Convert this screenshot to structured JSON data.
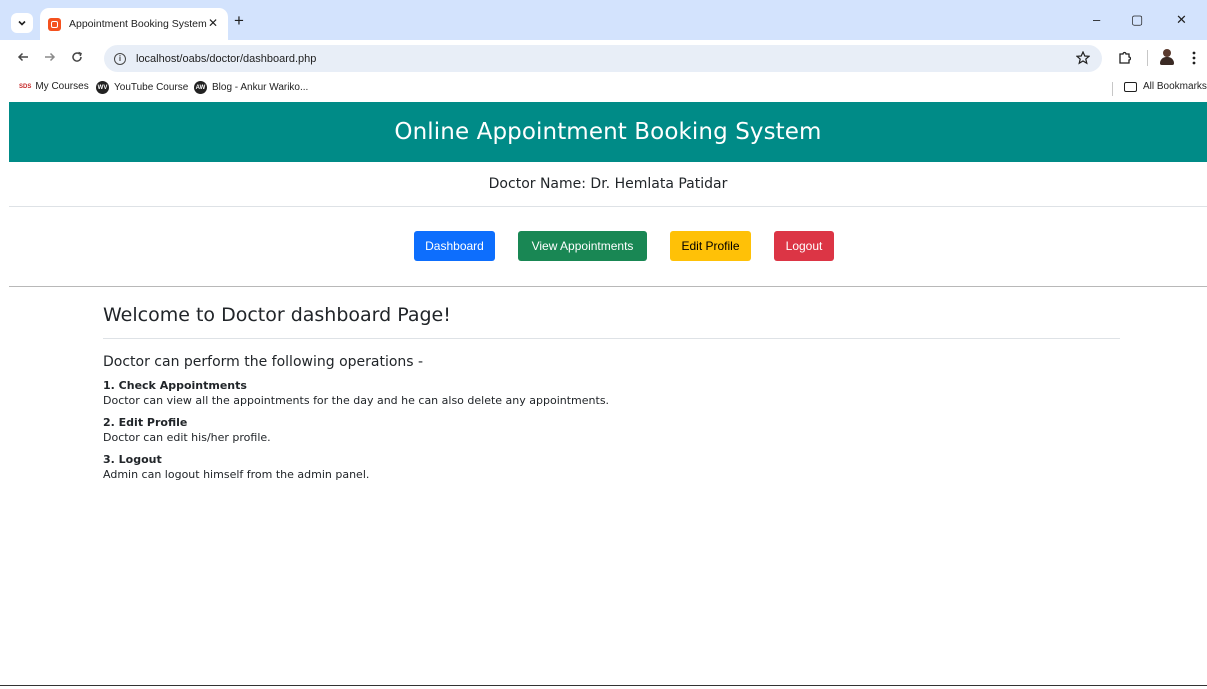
{
  "browser": {
    "tab_title": "Appointment Booking System",
    "tab_close": "✕",
    "new_tab": "+",
    "url": "localhost/oabs/doctor/dashboard.php",
    "icons": {
      "back": "back-arrow-icon",
      "forward": "forward-arrow-icon",
      "reload": "reload-icon",
      "site_info": "info-icon",
      "bookmark_star": "star-icon",
      "extensions": "puzzle-icon",
      "menu": "kebab-menu-icon"
    },
    "window_controls": {
      "minimize": "–",
      "restore": "▢",
      "close": "✕"
    }
  },
  "bookmarks": [
    {
      "label": "My Courses",
      "icon": "bookmark-logo-icon",
      "mark": "SDS"
    },
    {
      "label": "YouTube Course",
      "icon": "wv-logo-icon",
      "mark": "WV"
    },
    {
      "label": "Blog - Ankur Wariko...",
      "icon": "aw-logo-icon",
      "mark": "AW"
    }
  ],
  "all_bookmarks_label": "All Bookmarks",
  "site": {
    "title": "Online Appointment Booking System",
    "doctor_name": "Doctor Name: Dr. Hemlata Patidar",
    "colors": {
      "header": "#008b87"
    }
  },
  "nav_buttons": [
    {
      "label": "Dashboard",
      "color": "#0d6efd"
    },
    {
      "label": "View Appointments",
      "color": "#198754"
    },
    {
      "label": "Edit Profile",
      "color": "#ffc107"
    },
    {
      "label": "Logout",
      "color": "#dc3545"
    }
  ],
  "content": {
    "welcome": "Welcome to Doctor dashboard Page!",
    "ops_title": "Doctor can perform the following operations -",
    "operations": [
      {
        "title": "1. Check Appointments",
        "desc": "Doctor can view all the appointments for the day and he can also delete any appointments."
      },
      {
        "title": "2. Edit Profile",
        "desc": "Doctor can edit his/her profile."
      },
      {
        "title": "3. Logout",
        "desc": "Admin can logout himself from the admin panel."
      }
    ]
  }
}
